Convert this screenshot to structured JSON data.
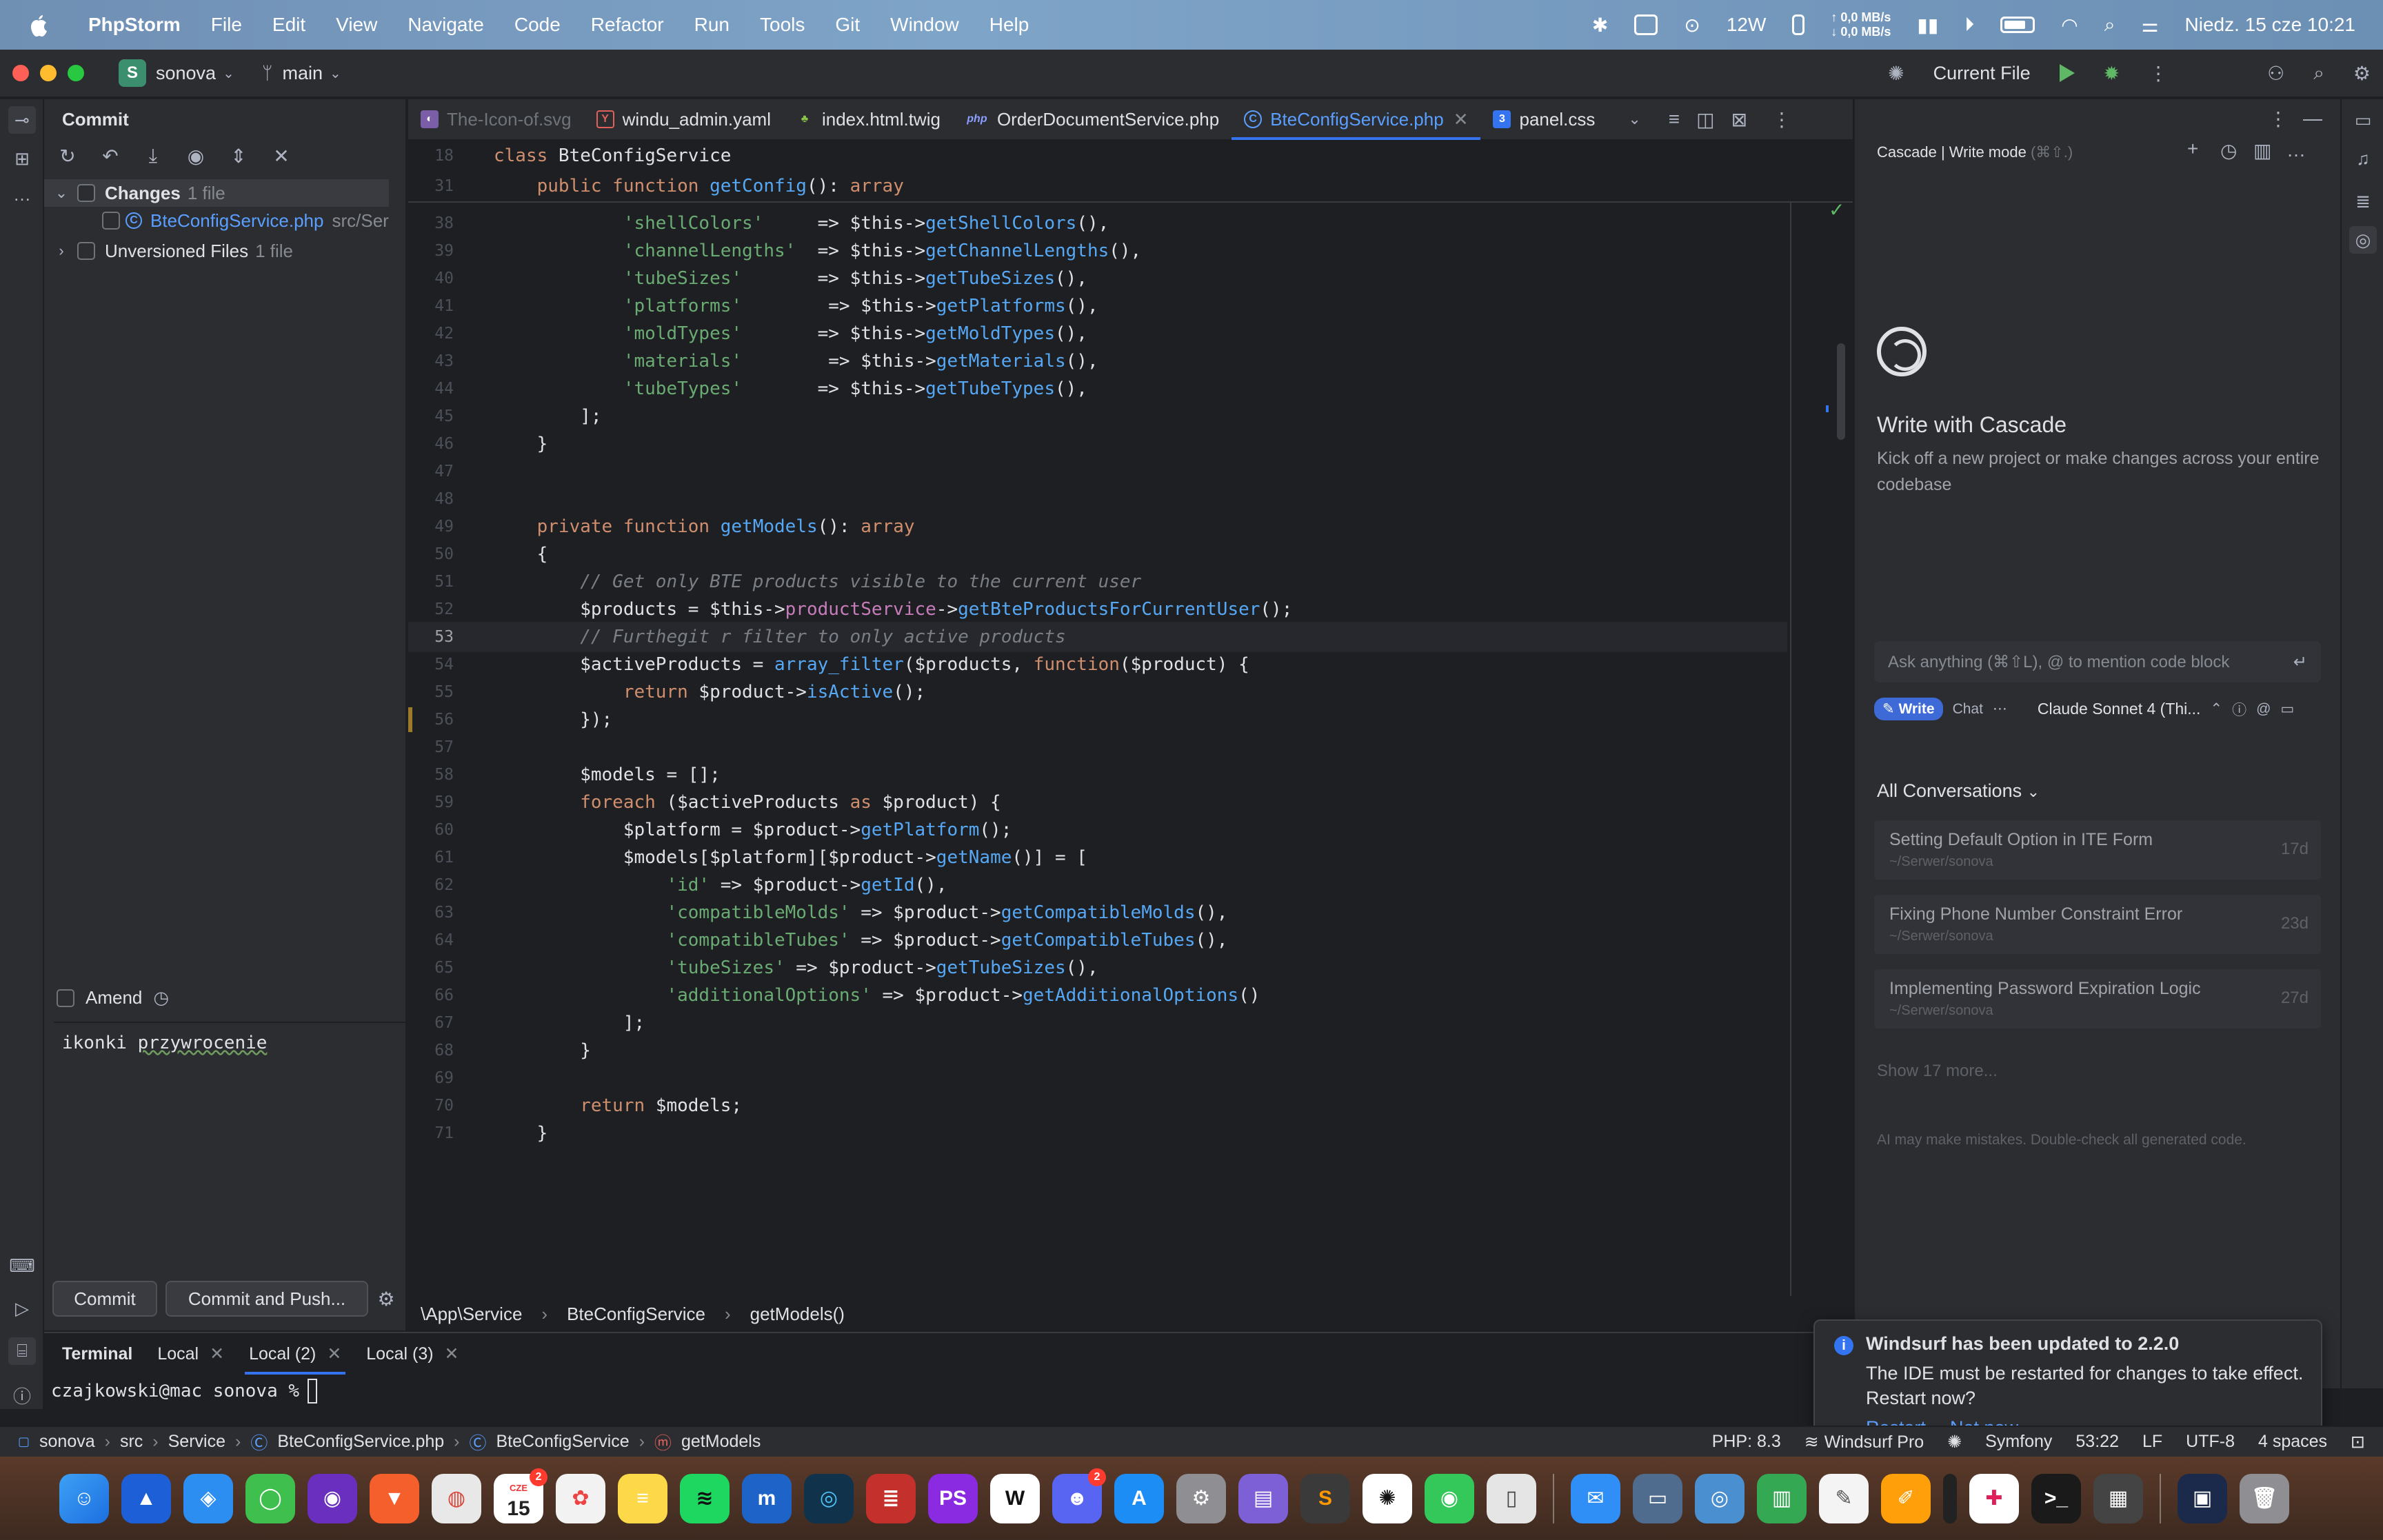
{
  "menubar": {
    "app": "PhpStorm",
    "items": [
      "File",
      "Edit",
      "View",
      "Navigate",
      "Code",
      "Refactor",
      "Run",
      "Tools",
      "Git",
      "Window",
      "Help"
    ],
    "net_up": "↑ 0,0 MB/s",
    "net_down": "↓ 0,0 MB/s",
    "power": "12W",
    "datetime": "Niedz. 15 cze  10:21"
  },
  "titlebar": {
    "project_initial": "S",
    "project": "sonova",
    "branch": "main",
    "run_config": "Current File"
  },
  "commit": {
    "title": "Commit",
    "changes_label": "Changes",
    "changes_count": "1 file",
    "file": "BteConfigService.php",
    "file_path": "src/Ser",
    "unversioned_label": "Unversioned Files",
    "unversioned_count": "1 file",
    "amend": "Amend",
    "message_word1": "ikonki",
    "message_word2": "przywrocenie",
    "commit_btn": "Commit",
    "commit_push_btn": "Commit and Push..."
  },
  "tabs": [
    {
      "label": "The-Icon-of.svg"
    },
    {
      "label": "windu_admin.yaml"
    },
    {
      "label": "index.html.twig"
    },
    {
      "label": "OrderDocumentService.php"
    },
    {
      "label": "BteConfigService.php"
    },
    {
      "label": "panel.css"
    }
  ],
  "editor": {
    "sticky": [
      {
        "n": "18",
        "segs": [
          [
            "k",
            "class "
          ],
          [
            "cls",
            "BteConfigService"
          ]
        ]
      },
      {
        "n": "31",
        "segs": [
          [
            "k",
            "    public function "
          ],
          [
            "f",
            "getConfig"
          ],
          [
            "t",
            "(): "
          ],
          [
            "k",
            "array"
          ]
        ]
      }
    ],
    "lines": [
      {
        "n": "38",
        "segs": [
          [
            "t",
            "            "
          ],
          [
            "s",
            "'shellColors'"
          ],
          [
            "t",
            "     => $this->"
          ],
          [
            "f",
            "getShellColors"
          ],
          [
            "t",
            "(),"
          ]
        ]
      },
      {
        "n": "39",
        "segs": [
          [
            "t",
            "            "
          ],
          [
            "s",
            "'channelLengths'"
          ],
          [
            "t",
            "  => $this->"
          ],
          [
            "f",
            "getChannelLengths"
          ],
          [
            "t",
            "(),"
          ]
        ]
      },
      {
        "n": "40",
        "segs": [
          [
            "t",
            "            "
          ],
          [
            "s",
            "'tubeSizes'"
          ],
          [
            "t",
            "       => $this->"
          ],
          [
            "f",
            "getTubeSizes"
          ],
          [
            "t",
            "(),"
          ]
        ]
      },
      {
        "n": "41",
        "segs": [
          [
            "t",
            "            "
          ],
          [
            "s",
            "'platforms'"
          ],
          [
            "t",
            "        => $this->"
          ],
          [
            "f",
            "getPlatforms"
          ],
          [
            "t",
            "(),"
          ]
        ]
      },
      {
        "n": "42",
        "segs": [
          [
            "t",
            "            "
          ],
          [
            "s",
            "'moldTypes'"
          ],
          [
            "t",
            "       => $this->"
          ],
          [
            "f",
            "getMoldTypes"
          ],
          [
            "t",
            "(),"
          ]
        ]
      },
      {
        "n": "43",
        "segs": [
          [
            "t",
            "            "
          ],
          [
            "s",
            "'materials'"
          ],
          [
            "t",
            "        => $this->"
          ],
          [
            "f",
            "getMaterials"
          ],
          [
            "t",
            "(),"
          ]
        ]
      },
      {
        "n": "44",
        "segs": [
          [
            "t",
            "            "
          ],
          [
            "s",
            "'tubeTypes'"
          ],
          [
            "t",
            "       => $this->"
          ],
          [
            "f",
            "getTubeTypes"
          ],
          [
            "t",
            "(),"
          ]
        ]
      },
      {
        "n": "45",
        "segs": [
          [
            "t",
            "        ];"
          ]
        ]
      },
      {
        "n": "46",
        "segs": [
          [
            "t",
            "    }"
          ]
        ]
      },
      {
        "n": "47",
        "segs": []
      },
      {
        "n": "48",
        "segs": []
      },
      {
        "n": "49",
        "segs": [
          [
            "k",
            "    private function "
          ],
          [
            "f",
            "getModels"
          ],
          [
            "t",
            "(): "
          ],
          [
            "k",
            "array"
          ]
        ]
      },
      {
        "n": "50",
        "segs": [
          [
            "t",
            "    {"
          ]
        ]
      },
      {
        "n": "51",
        "segs": [
          [
            "c",
            "        // Get only BTE products visible to the current user"
          ]
        ]
      },
      {
        "n": "52",
        "segs": [
          [
            "t",
            "        $products = $this->"
          ],
          [
            "pr",
            "productService"
          ],
          [
            "t",
            "->"
          ],
          [
            "f",
            "getBteProductsForCurrentUser"
          ],
          [
            "t",
            "();"
          ]
        ]
      },
      {
        "n": "53",
        "segs": [
          [
            "c",
            "        // Furthegit r filter to only active products"
          ]
        ]
      },
      {
        "n": "54",
        "segs": [
          [
            "t",
            "        $activeProducts = "
          ],
          [
            "f",
            "array_filter"
          ],
          [
            "t",
            "($products, "
          ],
          [
            "k",
            "function"
          ],
          [
            "t",
            "($product) {"
          ]
        ]
      },
      {
        "n": "55",
        "segs": [
          [
            "k",
            "            return "
          ],
          [
            "t",
            "$product->"
          ],
          [
            "f",
            "isActive"
          ],
          [
            "t",
            "();"
          ]
        ]
      },
      {
        "n": "56",
        "segs": [
          [
            "t",
            "        });"
          ]
        ]
      },
      {
        "n": "57",
        "segs": []
      },
      {
        "n": "58",
        "segs": [
          [
            "t",
            "        $models = [];"
          ]
        ]
      },
      {
        "n": "59",
        "segs": [
          [
            "k",
            "        foreach "
          ],
          [
            "t",
            "($activeProducts "
          ],
          [
            "k",
            "as"
          ],
          [
            "t",
            " $product) {"
          ]
        ]
      },
      {
        "n": "60",
        "segs": [
          [
            "t",
            "            $platform = $product->"
          ],
          [
            "f",
            "getPlatform"
          ],
          [
            "t",
            "();"
          ]
        ]
      },
      {
        "n": "61",
        "segs": [
          [
            "t",
            "            $models[$platform][$product->"
          ],
          [
            "f",
            "getName"
          ],
          [
            "t",
            "()] = ["
          ]
        ]
      },
      {
        "n": "62",
        "segs": [
          [
            "t",
            "                "
          ],
          [
            "s",
            "'id'"
          ],
          [
            "t",
            " => $product->"
          ],
          [
            "f",
            "getId"
          ],
          [
            "t",
            "(),"
          ]
        ]
      },
      {
        "n": "63",
        "segs": [
          [
            "t",
            "                "
          ],
          [
            "s",
            "'compatibleMolds'"
          ],
          [
            "t",
            " => $product->"
          ],
          [
            "f",
            "getCompatibleMolds"
          ],
          [
            "t",
            "(),"
          ]
        ]
      },
      {
        "n": "64",
        "segs": [
          [
            "t",
            "                "
          ],
          [
            "s",
            "'compatibleTubes'"
          ],
          [
            "t",
            " => $product->"
          ],
          [
            "f",
            "getCompatibleTubes"
          ],
          [
            "t",
            "(),"
          ]
        ]
      },
      {
        "n": "65",
        "segs": [
          [
            "t",
            "                "
          ],
          [
            "s",
            "'tubeSizes'"
          ],
          [
            "t",
            " => $product->"
          ],
          [
            "f",
            "getTubeSizes"
          ],
          [
            "t",
            "(),"
          ]
        ]
      },
      {
        "n": "66",
        "segs": [
          [
            "t",
            "                "
          ],
          [
            "s",
            "'additionalOptions'"
          ],
          [
            "t",
            " => $product->"
          ],
          [
            "f",
            "getAdditionalOptions"
          ],
          [
            "t",
            "()"
          ]
        ]
      },
      {
        "n": "67",
        "segs": [
          [
            "t",
            "            ];"
          ]
        ]
      },
      {
        "n": "68",
        "segs": [
          [
            "t",
            "        }"
          ]
        ]
      },
      {
        "n": "69",
        "segs": []
      },
      {
        "n": "70",
        "segs": [
          [
            "k",
            "        return "
          ],
          [
            "t",
            "$models;"
          ]
        ]
      },
      {
        "n": "71",
        "segs": [
          [
            "t",
            "    }"
          ]
        ]
      }
    ],
    "current_line": "53",
    "breadcrumb": [
      "\\App\\Service",
      "BteConfigService",
      "getModels()"
    ]
  },
  "cascade": {
    "header": "Cascade | Write mode",
    "header_hint": "(⌘⇧.)",
    "title": "Write with Cascade",
    "subtitle": "Kick off a new project or make changes across your entire codebase",
    "ask_placeholder": "Ask anything (⌘⇧L), @ to mention code block",
    "mode_write": "Write",
    "mode_chat": "Chat",
    "model": "Claude Sonnet 4 (Thi...",
    "all_conversations": "All Conversations",
    "conversations": [
      {
        "title": "Setting Default Option in ITE Form",
        "path": "~/Serwer/sonova",
        "age": "17d"
      },
      {
        "title": "Fixing Phone Number Constraint Error",
        "path": "~/Serwer/sonova",
        "age": "23d"
      },
      {
        "title": "Implementing Password Expiration Logic",
        "path": "~/Serwer/sonova",
        "age": "27d"
      }
    ],
    "show_more": "Show 17 more...",
    "disclaimer": "AI may make mistakes. Double-check all generated code."
  },
  "terminal": {
    "title": "Terminal",
    "tabs": [
      "Local",
      "Local (2)",
      "Local (3)"
    ],
    "prompt": "czajkowski@mac sonova %"
  },
  "notification": {
    "title": "Windsurf has been updated to 2.2.0",
    "body": "The IDE must be restarted for changes to take effect. Restart now?",
    "restart": "Restart",
    "not_now": "Not now"
  },
  "statusbar": {
    "crumbs": [
      "sonova",
      "src",
      "Service",
      "BteConfigService.php",
      "BteConfigService",
      "getModels"
    ],
    "php": "PHP: 8.3",
    "windsurf": "Windsurf Pro",
    "framework": "Symfony",
    "position": "53:22",
    "line_sep": "LF",
    "encoding": "UTF-8",
    "indent": "4 spaces"
  },
  "dock": {
    "calendar_month": "CZE",
    "calendar_day": "15",
    "calendar_badge": "2",
    "discord_badge": "2"
  }
}
